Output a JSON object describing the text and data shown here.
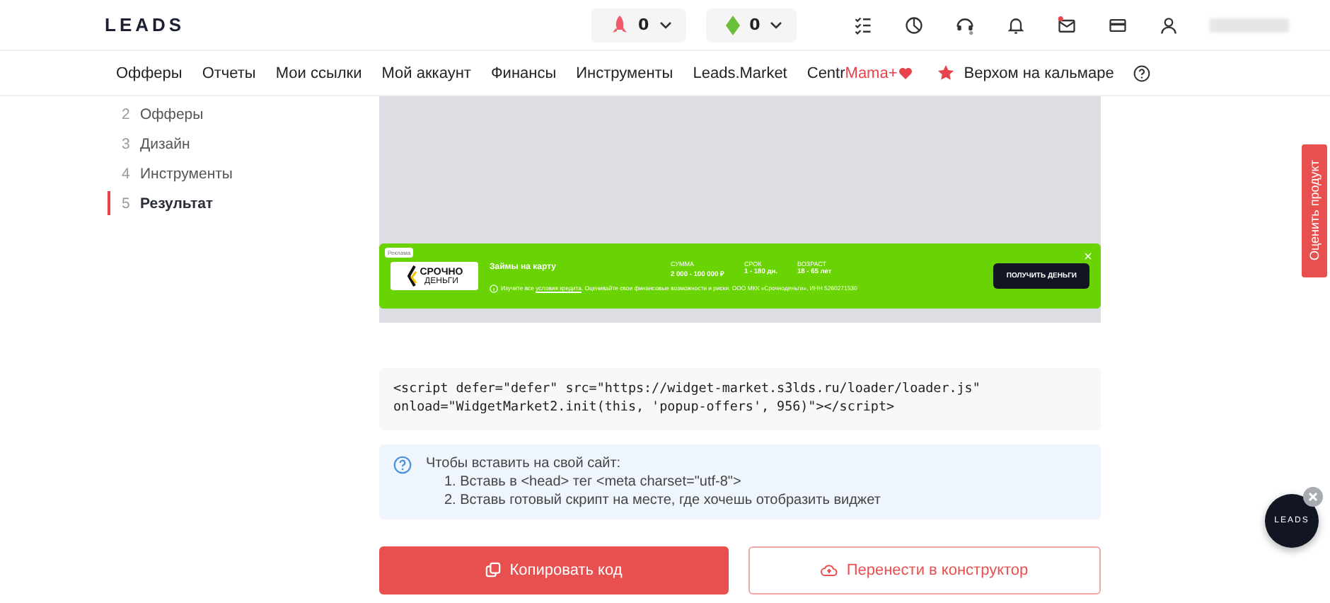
{
  "header": {
    "logo": "LEADS",
    "counters": [
      {
        "kind": "rocket",
        "value": "0"
      },
      {
        "kind": "gem",
        "value": "0"
      }
    ],
    "icons": [
      {
        "kind": "checklist"
      },
      {
        "kind": "pie"
      },
      {
        "kind": "support"
      },
      {
        "kind": "bell"
      },
      {
        "kind": "mail"
      },
      {
        "kind": "card"
      },
      {
        "kind": "user"
      }
    ],
    "mail_unread": true
  },
  "nav": [
    {
      "kind": "plain",
      "label": "Офферы"
    },
    {
      "kind": "plain",
      "label": "Отчеты"
    },
    {
      "kind": "plain",
      "label": "Мои ссылки"
    },
    {
      "kind": "plain",
      "label": "Мой аккаунт"
    },
    {
      "kind": "plain",
      "label": "Финансы"
    },
    {
      "kind": "plain",
      "label": "Инструменты"
    },
    {
      "kind": "plain",
      "label": "Leads.Market"
    },
    {
      "kind": "heart",
      "label": "Centr",
      "accent": "Mama+"
    },
    {
      "kind": "star",
      "label": "Верхом на кальмаре"
    },
    {
      "kind": "help"
    }
  ],
  "steps": [
    {
      "number": "2",
      "label": "Офферы",
      "selected": false
    },
    {
      "number": "3",
      "label": "Дизайн",
      "selected": false
    },
    {
      "number": "4",
      "label": "Инструменты",
      "selected": false
    },
    {
      "number": "5",
      "label": "Результат",
      "selected": true
    }
  ],
  "banner": {
    "badge": "Реклама",
    "logo_top": "СРОЧНО",
    "logo_bottom": "ДЕНЬГИ",
    "title": "Займы на карту",
    "facts": [
      {
        "label": "СУММА",
        "value": "2 000 - 100 000 ₽"
      },
      {
        "label": "СРОК",
        "value": "1 - 180 дн."
      },
      {
        "label": "ВОЗРАСТ",
        "value": "18 - 65 лет"
      }
    ],
    "button": "ПОЛУЧИТЬ ДЕНЬГИ",
    "disclaimer_before": "Изучите все ",
    "disclaimer_link": "условия кредита",
    "disclaimer_after": ". Оценивайте свои финансовые возможности и риски. ООО МКК «Срочноденьги», ИНН 5260271530"
  },
  "code": "<script defer=\"defer\" src=\"https://widget-market.s3lds.ru/loader/loader.js\"\nonload=\"WidgetMarket2.init(this, 'popup-offers', 956)\"></script>",
  "help": {
    "title": "Чтобы вставить на свой сайт:",
    "steps": [
      "1. Вставь в <head> тег <meta charset=\"utf-8\">",
      "2. Вставь готовый скрипт на месте, где хочешь отобразить виджет"
    ]
  },
  "buttons": [
    {
      "kind": "primary",
      "label": "Копировать код"
    },
    {
      "kind": "outline",
      "label": "Перенести в конструктор"
    }
  ],
  "feedback_tab": "Оценить продукт",
  "chat_widget": "LEADS"
}
